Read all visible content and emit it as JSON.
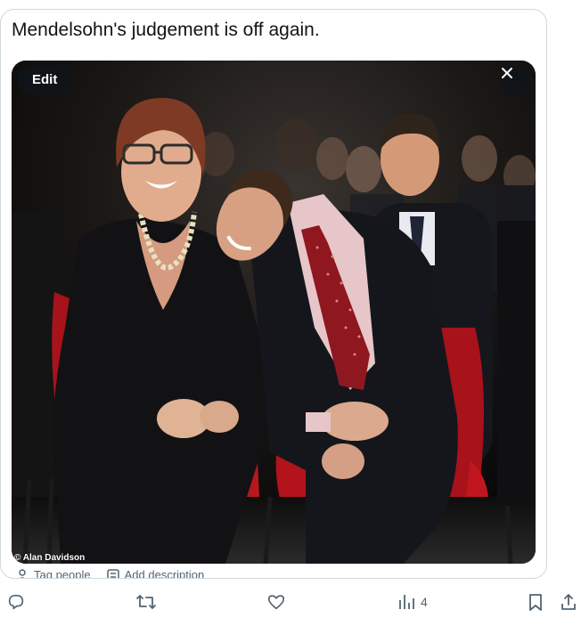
{
  "tweet": {
    "text": "Mendelsohn's judgement is off again."
  },
  "media": {
    "edit_label": "Edit",
    "credit": "© Alan Davidson"
  },
  "meta": {
    "tag_people": "Tag people",
    "add_description": "Add description"
  },
  "actions": {
    "views_count": "4"
  },
  "colors": {
    "border": "#cfd9de",
    "icon_gray": "#536471",
    "chair_red": "#b3131b",
    "tie_red": "#8f1720"
  },
  "icons": [
    "close-icon",
    "reply-icon",
    "retweet-icon",
    "like-icon",
    "views-icon",
    "bookmark-icon",
    "share-icon",
    "person-icon",
    "description-icon"
  ]
}
